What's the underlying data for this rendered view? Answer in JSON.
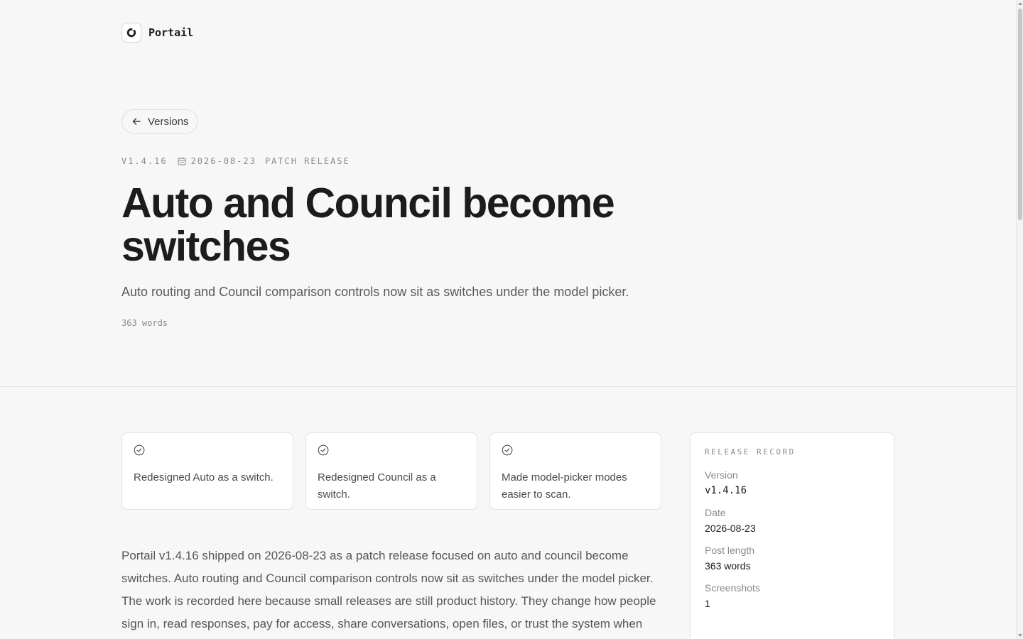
{
  "brand": {
    "name": "Portail",
    "logo_icon": "portail-logo-icon"
  },
  "back_link": {
    "label": "Versions",
    "icon": "arrow-left-icon"
  },
  "meta": {
    "version": "V1.4.16",
    "date_icon": "calendar-icon",
    "date": "2026-08-23",
    "release_type": "PATCH RELEASE"
  },
  "headline": {
    "title": "Auto and Council become switches",
    "subtitle": "Auto routing and Council comparison controls now sit as switches under the model picker.",
    "word_count": "363 words"
  },
  "highlights": [
    {
      "icon": "check-circle-icon",
      "text": "Redesigned Auto as a switch."
    },
    {
      "icon": "check-circle-icon",
      "text": "Redesigned Council as a switch."
    },
    {
      "icon": "check-circle-icon",
      "text": "Made model-picker modes easier to scan."
    }
  ],
  "body": {
    "paragraph": "Portail v1.4.16 shipped on 2026-08-23 as a patch release focused on auto and council become switches. Auto routing and Council comparison controls now sit as switches under the model picker. The work is recorded here because small releases are still product history. They change how people sign in, read responses, pay for access, share conversations, open files, or trust the system when"
  },
  "release_record": {
    "heading": "RELEASE RECORD",
    "rows": [
      {
        "label": "Version",
        "value": "v1.4.16"
      },
      {
        "label": "Date",
        "value": "2026-08-23"
      },
      {
        "label": "Post length",
        "value": "363 words"
      },
      {
        "label": "Screenshots",
        "value": "1"
      }
    ]
  },
  "colors": {
    "background": "#f7f7f7",
    "text_primary": "#1c1c1c",
    "text_muted": "#8a8a8a",
    "border": "#e2e2e2",
    "card_bg": "#ffffff"
  }
}
